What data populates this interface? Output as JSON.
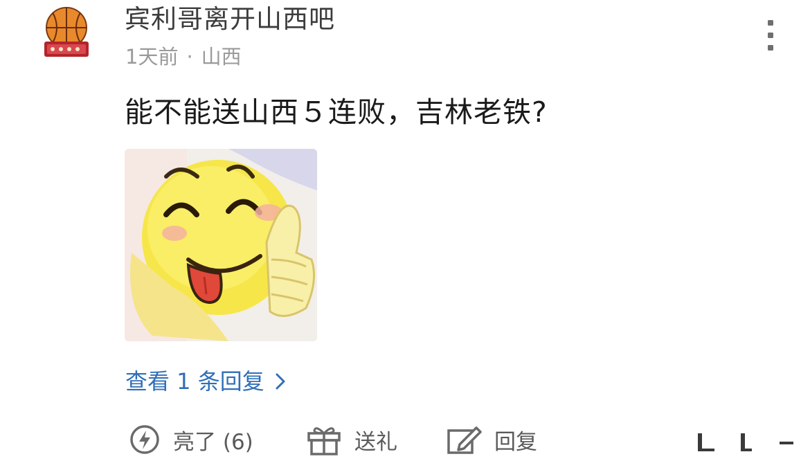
{
  "comment": {
    "username": "宾利哥离开山西吧",
    "time": "1天前",
    "separator": "·",
    "location": "山西",
    "text": "能不能送山西５连败，吉林老铁?",
    "view_replies": "查看 1 条回复"
  },
  "actions": {
    "like_label": "亮了 (6)",
    "gift_label": "送礼",
    "reply_label": "回复"
  },
  "icons": {
    "avatar": "basketball-logo-avatar",
    "more": "more-vertical-icon",
    "like": "lightning-icon",
    "gift": "gift-icon",
    "reply": "edit-icon",
    "chevron": "chevron-right-icon",
    "share": "share-icon"
  },
  "colors": {
    "link": "#2f6fb8",
    "meta": "#9a9a9a",
    "avatar_orange": "#e8892b",
    "avatar_red": "#b3242b"
  }
}
